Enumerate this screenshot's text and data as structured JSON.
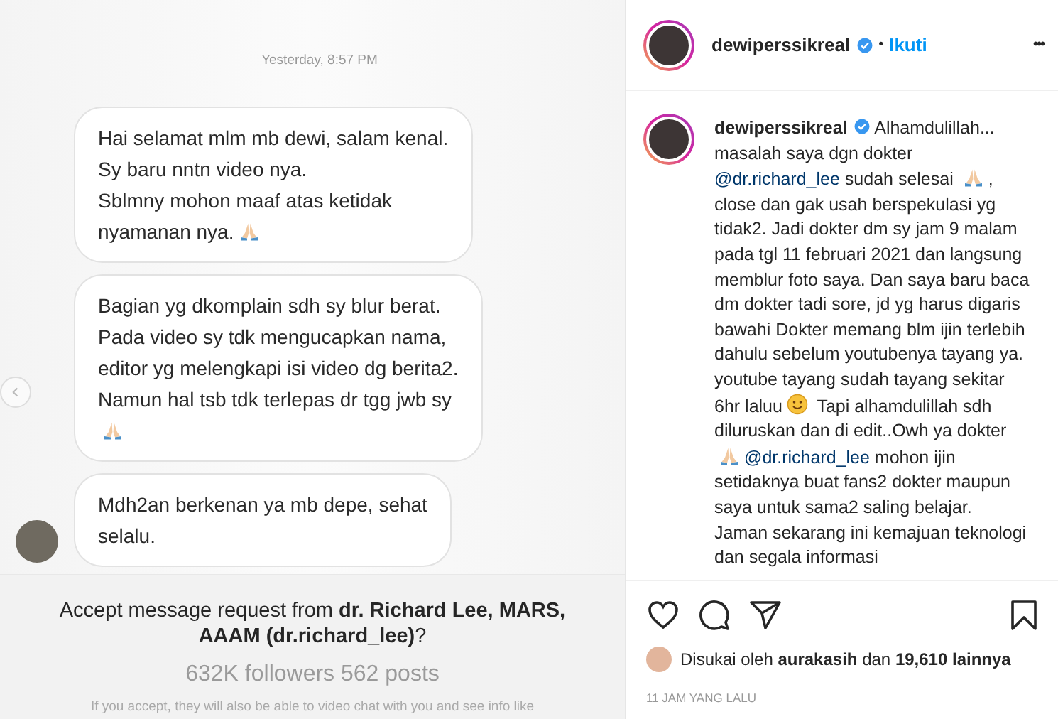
{
  "dm": {
    "timestamp": "Yesterday, 8:57 PM",
    "messages": [
      {
        "parts": [
          {
            "kind": "text",
            "text": "Hai selamat mlm mb dewi, salam kenal.\nSy baru nntn video nya.\nSblmny mohon maaf atas ketidak\nnyamanan nya."
          },
          {
            "kind": "pray"
          }
        ],
        "show_avatar": false
      },
      {
        "parts": [
          {
            "kind": "text",
            "text": "Bagian yg dkomplain sdh sy blur berat.\nPada video sy tdk mengucapkan nama,\neditor yg melengkapi isi video dg berita2.\nNamun hal tsb tdk terlepas dr tgg jwb sy"
          },
          {
            "kind": "break"
          },
          {
            "kind": "pray"
          }
        ],
        "show_avatar": false
      },
      {
        "parts": [
          {
            "kind": "text",
            "text": "Mdh2an berkenan ya mb depe, sehat\nselalu."
          }
        ],
        "show_avatar": true
      }
    ],
    "request": {
      "prompt": "Accept message request from **dr. Richard Lee, MARS, AAAM (dr.richard_lee)**?",
      "stats": "632K followers 562 posts",
      "note": "If you accept, they will also be able to video chat with you and see info like"
    }
  },
  "post": {
    "username": "dewiperssikreal",
    "verified": true,
    "separator": "•",
    "follow": "Ikuti",
    "more": "•••",
    "caption": {
      "username": "dewiperssikreal",
      "verified": true,
      "segments": [
        {
          "kind": "text",
          "text": "Alhamdulillah... masalah saya dgn dokter "
        },
        {
          "kind": "mention",
          "text": "@dr.richard_lee"
        },
        {
          "kind": "text",
          "text": " sudah selesai "
        },
        {
          "kind": "pray"
        },
        {
          "kind": "text",
          "text": ", close dan gak usah berspekulasi yg tidak2. Jadi dokter dm sy jam 9 malam pada tgl 11 februari 2021 dan langsung memblur foto saya. Dan saya baru baca dm dokter tadi sore, jd yg harus digaris bawahi Dokter memang blm ijin terlebih dahulu sebelum youtubenya tayang ya. youtube tayang sudah tayang sekitar 6hr laluu"
        },
        {
          "kind": "smile"
        },
        {
          "kind": "text",
          "text": " Tapi alhamdulillah sdh diluruskan dan di edit..Owh ya dokter "
        },
        {
          "kind": "pray"
        },
        {
          "kind": "mention",
          "text": "@dr.richard_lee"
        },
        {
          "kind": "text",
          "text": " mohon ijin setidaknya buat fans2 dokter maupun saya untuk sama2 saling belajar. Jaman sekarang ini kemajuan teknologi dan segala informasi"
        }
      ]
    },
    "liked": false,
    "saved": false,
    "likes": "Disukai oleh **aurakasih** dan **19,610 lainnya**",
    "time": "11 JAM YANG LALU"
  }
}
